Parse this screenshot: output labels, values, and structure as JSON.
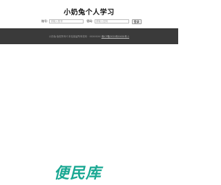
{
  "header": {
    "title": "小奶兔个人学习"
  },
  "login": {
    "account_label": "账号:",
    "account_placeholder": "请输入账号",
    "password_label": "密码:",
    "password_placeholder": "请输入密码",
    "submit_label": "登录"
  },
  "footer": {
    "copyright": "小奶兔·版权所有©本站保留所有权利 · XXXXXXX",
    "icp_link": "粤ICP备2020年XXXX号-1"
  },
  "branding": {
    "logo_text": "便民库",
    "logo_color": "#1aa893"
  },
  "colors": {
    "band_background": "#3a3a3a",
    "page_background": "#ffffff"
  }
}
